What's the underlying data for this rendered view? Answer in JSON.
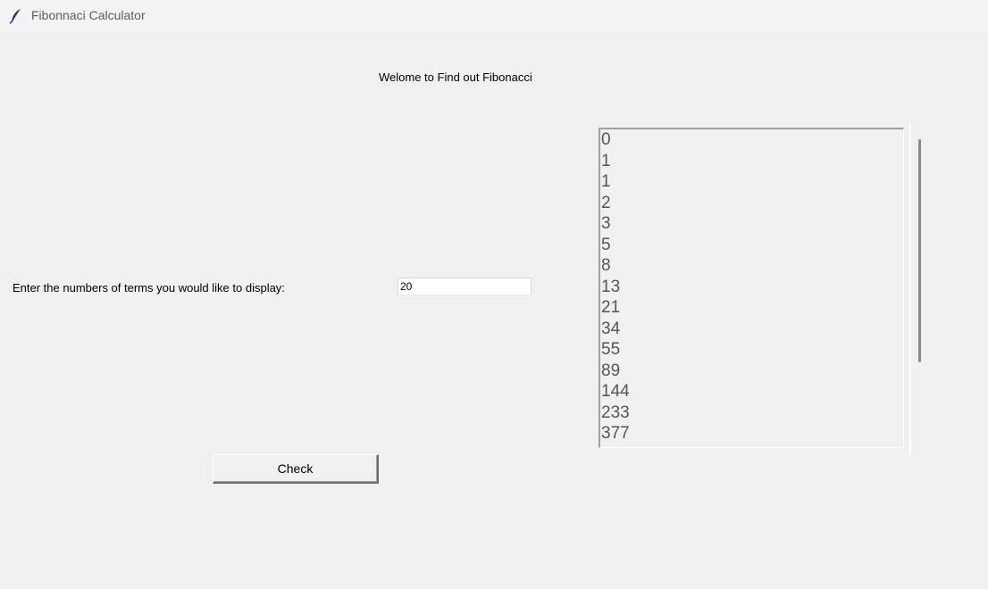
{
  "window": {
    "title": "Fibonnaci Calculator",
    "icon": "feather-icon"
  },
  "main": {
    "welcome_text": "Welome to Find out Fibonacci",
    "prompt_label": "Enter the numbers of terms you would like to display:",
    "terms_value": "20",
    "check_label": "Check"
  },
  "results": {
    "items": [
      "0",
      "1",
      "1",
      "2",
      "3",
      "5",
      "8",
      "13",
      "21",
      "34",
      "55",
      "89",
      "144",
      "233",
      "377"
    ]
  },
  "colors": {
    "background": "#f0f0f0",
    "list_text": "#555555"
  }
}
